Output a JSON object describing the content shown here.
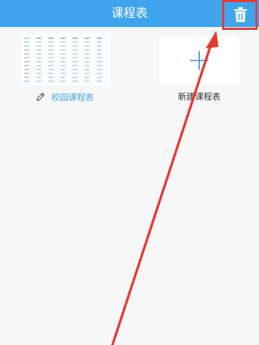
{
  "header": {
    "title": "课程表"
  },
  "icons": {
    "trash": "trash-icon",
    "pencil": "pencil-icon",
    "plus": "plus-icon"
  },
  "cards": [
    {
      "name": "校园课程表"
    },
    {
      "name": "新建课程表"
    }
  ],
  "colors": {
    "header": "#3fa4ec",
    "highlight": "#e53935",
    "link_text": "#4aa6e2",
    "background": "#f7f7f8"
  }
}
